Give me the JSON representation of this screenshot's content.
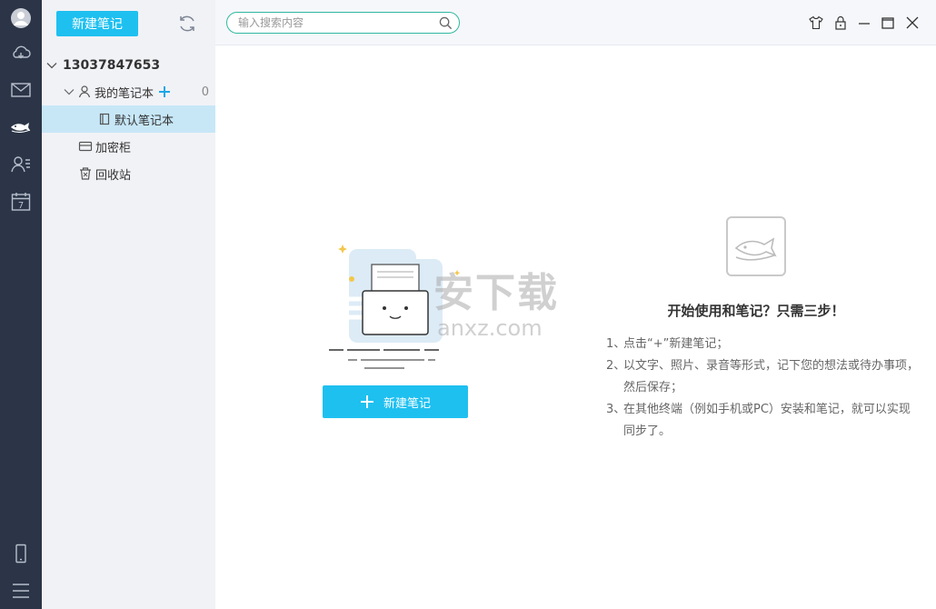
{
  "rail": {
    "items": [
      "avatar-icon",
      "cloud-icon",
      "mail-icon",
      "fish-icon",
      "contacts-icon",
      "calendar-icon"
    ],
    "calendar_day": "7",
    "bottom": [
      "phone-icon",
      "menu-icon"
    ]
  },
  "tree": {
    "new_note_label": "新建笔记",
    "account": "13037847653",
    "my_notebook": "我的笔记本",
    "my_notebook_count": "0",
    "default_notebook": "默认笔记本",
    "safe": "加密柜",
    "trash": "回收站"
  },
  "search": {
    "placeholder": "输入搜索内容",
    "value": ""
  },
  "window": {
    "controls": [
      "shirt-icon",
      "lock-icon",
      "minimize-icon",
      "maximize-icon",
      "close-icon"
    ]
  },
  "main": {
    "new_note_label": "新建笔记",
    "watermark": "安下载",
    "watermark_sub": "anxz.com",
    "title": "开始使用和笔记？只需三步！",
    "steps": [
      {
        "num": "1、",
        "text": "点击“+”新建笔记；"
      },
      {
        "num": "2、",
        "text": "以文字、照片、录音等形式，记下您的想法或待办事项，然后保存；"
      },
      {
        "num": "3、",
        "text": "在其他终端（例如手机或PC）安装和笔记，就可以实现同步了。"
      }
    ]
  },
  "colors": {
    "accent": "#1ec0f0",
    "rail": "#2b3547",
    "tree_bg": "#f1f2f6",
    "selected": "#c7e7f7"
  }
}
